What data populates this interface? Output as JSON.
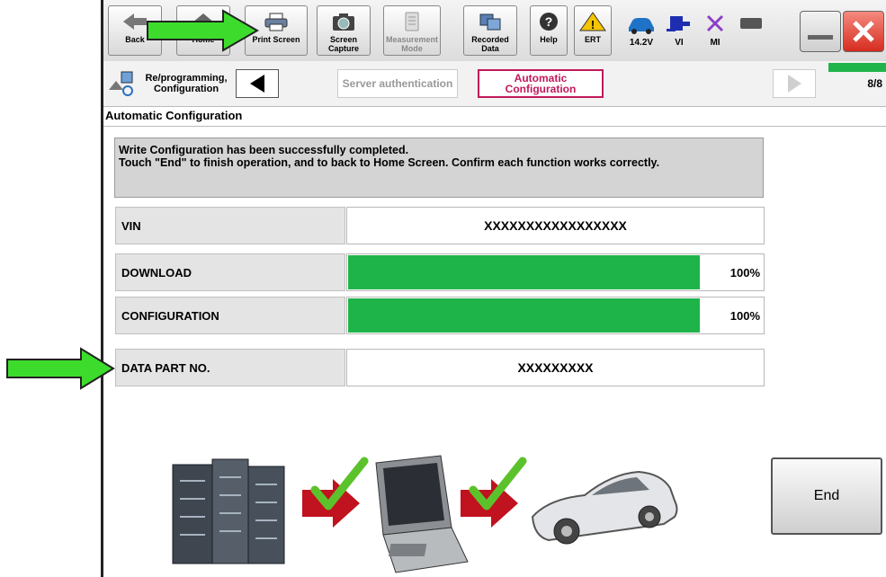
{
  "toolbar": {
    "back_label": "Back",
    "home_label": "Home",
    "print_label": "Print Screen",
    "capture_label_1": "Screen",
    "capture_label_2": "Capture",
    "measure_label_1": "Measurement",
    "measure_label_2": "Mode",
    "recorded_label_1": "Recorded",
    "recorded_label_2": "Data",
    "help_label": "Help",
    "ert_label": "ERT",
    "voltage_label": "14.2V",
    "vi_label": "VI",
    "mi_label": "MI"
  },
  "steps": {
    "reprog_label_1": "Re/programming,",
    "reprog_label_2": "Configuration",
    "server_label": "Server authentication",
    "auto_label_1": "Automatic",
    "auto_label_2": "Configuration",
    "page_counter": "8/8"
  },
  "section_title": "Automatic Configuration",
  "message": {
    "line1": "Write Configuration has been successfully completed.",
    "line2": "Touch \"End\" to finish operation, and to back to Home Screen. Confirm each function works correctly."
  },
  "rows": {
    "vin_label": "VIN",
    "vin_value": "XXXXXXXXXXXXXXXXX",
    "download_label": "DOWNLOAD",
    "download_pct": "100%",
    "download_fraction": 1.0,
    "config_label": "CONFIGURATION",
    "config_pct": "100%",
    "config_fraction": 1.0,
    "part_label": "DATA PART NO.",
    "part_value": "XXXXXXXXX"
  },
  "end_label": "End",
  "colors": {
    "progress_green": "#1fb44a",
    "callout_arrow": "#3ddc2c",
    "active_step_border": "#c2185b",
    "close_red": "#e23a2e"
  },
  "icons": [
    "back-arrow-icon",
    "home-icon",
    "printer-icon",
    "camera-icon",
    "measurement-icon",
    "recorded-data-icon",
    "help-icon",
    "warning-icon",
    "car-battery-icon",
    "vi-icon",
    "mi-icon",
    "battery-icon",
    "minimize-icon",
    "close-icon",
    "server-icon",
    "checkmark-icon",
    "laptop-icon",
    "car-icon"
  ]
}
